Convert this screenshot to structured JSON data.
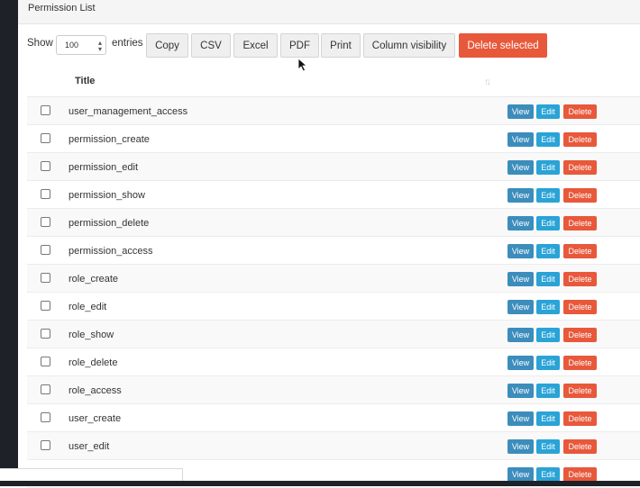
{
  "panel": {
    "title": "Permission List"
  },
  "toolbar": {
    "show_label": "Show",
    "page_length": "100",
    "entries_label": "entries",
    "buttons": [
      "Copy",
      "CSV",
      "Excel",
      "PDF",
      "Print",
      "Column visibility"
    ],
    "delete_selected": "Delete selected"
  },
  "table": {
    "header": {
      "title": "Title"
    },
    "rows": [
      "user_management_access",
      "permission_create",
      "permission_edit",
      "permission_show",
      "permission_delete",
      "permission_access",
      "role_create",
      "role_edit",
      "role_show",
      "role_delete",
      "role_access",
      "user_create",
      "user_edit",
      ""
    ],
    "actions": {
      "view": "View",
      "edit": "Edit",
      "delete": "Delete"
    }
  },
  "colors": {
    "view": "#3c8dbc",
    "edit": "#2aa3d6",
    "delete": "#e8583b",
    "delete_selected": "#e8583b"
  }
}
